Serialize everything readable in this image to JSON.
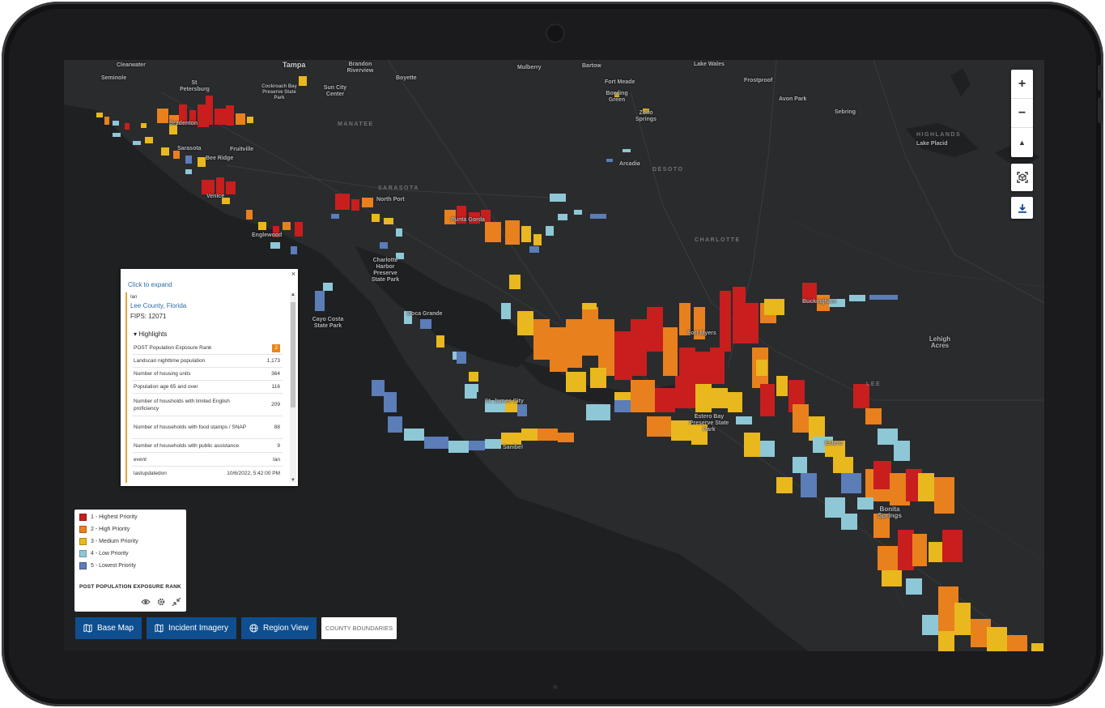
{
  "map": {
    "places": [
      {
        "name": "Clearwater",
        "cls": "place"
      },
      {
        "name": "Tampa",
        "cls": "place big"
      },
      {
        "name": "Brandon Riverview",
        "cls": "place"
      },
      {
        "name": "Mulberry",
        "cls": "place"
      },
      {
        "name": "Bartow",
        "cls": "place"
      },
      {
        "name": "Lake Wales",
        "cls": "place"
      },
      {
        "name": "Seminole",
        "cls": "place"
      },
      {
        "name": "St Petersburg",
        "cls": "place"
      },
      {
        "name": "Cockroach Bay Preserve State Park",
        "cls": "place"
      },
      {
        "name": "Sun City Center",
        "cls": "place"
      },
      {
        "name": "Boyette",
        "cls": "place"
      },
      {
        "name": "Fort Meade",
        "cls": "place"
      },
      {
        "name": "Frostproof",
        "cls": "place"
      },
      {
        "name": "Bowling Green",
        "cls": "place"
      },
      {
        "name": "Avon Park",
        "cls": "place"
      },
      {
        "name": "Zolfo Springs",
        "cls": "place"
      },
      {
        "name": "Sebring",
        "cls": "place"
      },
      {
        "name": "Bradenton",
        "cls": "place"
      },
      {
        "name": "Sarasota",
        "cls": "place"
      },
      {
        "name": "Fruitville",
        "cls": "place"
      },
      {
        "name": "Bee Ridge",
        "cls": "place"
      },
      {
        "name": "Lake Placid",
        "cls": "place"
      },
      {
        "name": "Arcadia",
        "cls": "place"
      },
      {
        "name": "Venice",
        "cls": "place"
      },
      {
        "name": "North Port",
        "cls": "place"
      },
      {
        "name": "Englewood",
        "cls": "place"
      },
      {
        "name": "Charlotte Harbor Preserve State Park",
        "cls": "place"
      },
      {
        "name": "Punta Gorda",
        "cls": "place"
      },
      {
        "name": "Cayo Costa State Park",
        "cls": "place"
      },
      {
        "name": "Boca Grande",
        "cls": "place"
      },
      {
        "name": "Fort Myers",
        "cls": "place"
      },
      {
        "name": "Lehigh Acres",
        "cls": "place med"
      },
      {
        "name": "Buckingham",
        "cls": "place"
      },
      {
        "name": "St. James City",
        "cls": "place"
      },
      {
        "name": "Sanibel",
        "cls": "place"
      },
      {
        "name": "Estero Bay Preserve State Park",
        "cls": "place"
      },
      {
        "name": "Estero",
        "cls": "place"
      },
      {
        "name": "Bonita Springs",
        "cls": "place med"
      }
    ],
    "counties": [
      "MANATEE",
      "HIGHLANDS",
      "SARASOTA",
      "DESOTO",
      "CHARLOTTE",
      "LEE"
    ]
  },
  "controls": {
    "zoom_in": "+",
    "zoom_out": "−",
    "compass": "▲",
    "icons": [
      "zoom-in-icon",
      "zoom-out-icon",
      "compass-icon",
      "view-3d-icon",
      "download-icon"
    ]
  },
  "popup": {
    "close": "×",
    "expand": "Click to expand",
    "event": "Ian",
    "county": "Lee County, Florida",
    "fips": "FIPS: 12071",
    "highlights": "▾ Highlights",
    "rows": [
      {
        "label": "POST Population Exposure Rank",
        "value": "2",
        "badge": true
      },
      {
        "label": "Landscan nighttime population",
        "value": "1,173"
      },
      {
        "label": "Number of housing units",
        "value": "364"
      },
      {
        "label": "Population age 65 and over",
        "value": "116"
      },
      {
        "label": "Number of housholds with limited English proficiency",
        "value": "209"
      },
      {
        "label": "Number of households with food stamps / SNAP",
        "value": "88"
      },
      {
        "label": "Number of households with public assistance",
        "value": "9"
      },
      {
        "label": "event",
        "value": "Ian"
      },
      {
        "label": "lastupdatedon",
        "value": "10/6/2022, 5:42:00 PM"
      }
    ]
  },
  "legend": {
    "title": "POST POPULATION EXPOSURE RANK",
    "items": [
      {
        "label": "1 - Highest Priority",
        "color": "#c81e1e"
      },
      {
        "label": "2 - High Priority",
        "color": "#e8801e"
      },
      {
        "label": "3 - Medium Priority",
        "color": "#e8b81e"
      },
      {
        "label": "4 - Low Priority",
        "color": "#8ec8d6"
      },
      {
        "label": "5 - Lowest Priority",
        "color": "#5b7db8"
      }
    ]
  },
  "buttons": {
    "base_map": "Base Map",
    "incident_imagery": "Incident Imagery",
    "region_view": "Region View",
    "county_boundaries": "County Boundaries"
  },
  "colors": {
    "rank1": "#c81e1e",
    "rank2": "#e8801e",
    "rank3": "#e8b81e",
    "rank4": "#8ec8d6",
    "rank5": "#5b7db8",
    "button_blue": "#0f4f8f"
  }
}
